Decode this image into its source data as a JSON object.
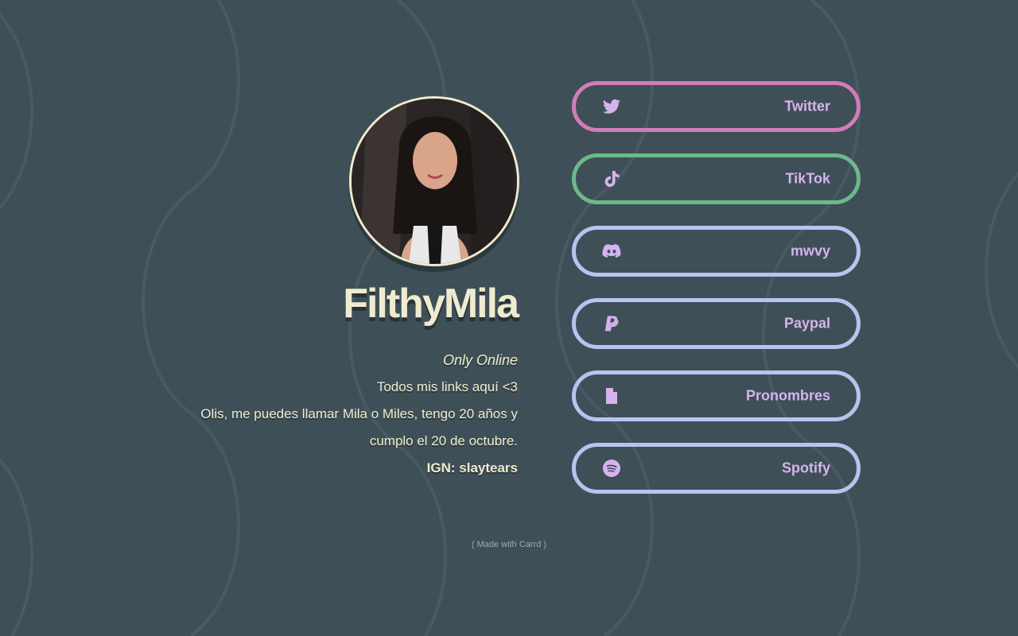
{
  "profile": {
    "name": "FilthyMila",
    "status": "Only Online",
    "tagline": "Todos mis links aquí <3",
    "bio_line1": "Olis, me puedes llamar Mila o Miles, tengo 20 años y",
    "bio_line2": "cumplo el 20 de octubre.",
    "ign": "IGN: slaytears"
  },
  "links": [
    {
      "label": "Twitter",
      "icon": "twitter-icon",
      "border": "#d37cb9"
    },
    {
      "label": "TikTok",
      "icon": "tiktok-icon",
      "border": "#6db88c"
    },
    {
      "label": "mwvy",
      "icon": "discord-icon",
      "border": "#b7c4ef"
    },
    {
      "label": "Paypal",
      "icon": "paypal-icon",
      "border": "#b7c4ef"
    },
    {
      "label": "Pronombres",
      "icon": "document-icon",
      "border": "#b7c4ef"
    },
    {
      "label": "Spotify",
      "icon": "spotify-icon",
      "border": "#b7c4ef"
    }
  ],
  "footer": {
    "text": "( Made with Carrd )"
  },
  "colors": {
    "background": "#3f4f57",
    "text": "#efebcf",
    "link_text": "#d6b3ee"
  }
}
